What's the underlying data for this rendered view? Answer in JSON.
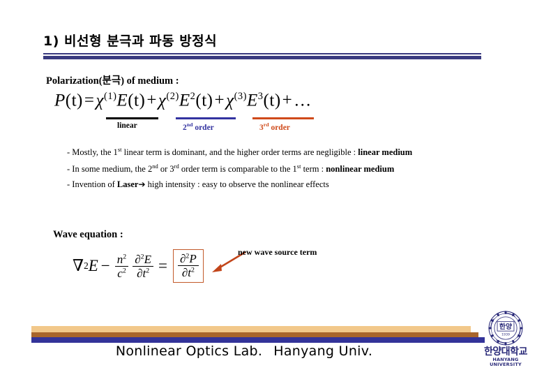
{
  "slide": {
    "title": "1) 비선형 분극과 파동 방정식",
    "rule_color": "#393a7f"
  },
  "polarization": {
    "heading": "Polarization(분극) of medium :",
    "equation_plain": "P(t) = χ(1)E(t) + χ(2)E2(t) + χ(3)E3(t) + ...",
    "lhs": "P",
    "lhs_arg": "(t)",
    "equals": "=",
    "terms": [
      {
        "chi": "χ",
        "chi_sup": "(1)",
        "field": "E",
        "field_sup": "",
        "arg": "(t)"
      },
      {
        "chi": "χ",
        "chi_sup": "(2)",
        "field": "E",
        "field_sup": "2",
        "arg": "(t)"
      },
      {
        "chi": "χ",
        "chi_sup": "(3)",
        "field": "E",
        "field_sup": "3",
        "arg": "(t)"
      }
    ],
    "plus": "+",
    "ellipsis": "…",
    "order_markers": [
      {
        "label_main": "linear",
        "label_sup": "",
        "label_tail": "",
        "color": "#000000"
      },
      {
        "label_main": "2",
        "label_sup": "nd",
        "label_tail": " order",
        "color": "#3333a0"
      },
      {
        "label_main": "3",
        "label_sup": "rd",
        "label_tail": " order",
        "color": "#cf4a1a"
      }
    ]
  },
  "bullets": [
    {
      "dash": "- ",
      "pre": "Mostly, the 1",
      "sup": "st",
      "mid": " linear term is dominant, and the higher order terms are negligible : ",
      "bold": "linear medium",
      "post": ""
    },
    {
      "dash": "- ",
      "pre": "In some medium, the 2",
      "sup": "nd",
      "mid": " or 3",
      "sup2": "rd",
      "mid2": " order term is comparable to the 1",
      "sup3": "st",
      "mid3": " term : ",
      "bold": "nonlinear medium",
      "post": ""
    },
    {
      "dash": "- ",
      "pre": "Invention of ",
      "bold": "Laser",
      "arrow": "➔",
      "post": " high intensity : easy to observe the nonlinear effects"
    }
  ],
  "wave": {
    "heading": "Wave equation :",
    "equation_plain": "∇²E − (n²/c²)(∂²E/∂t²) = ∂²P/∂t²",
    "nabla": "∇",
    "nabla_sup": "2",
    "field": "E",
    "minus": "−",
    "frac1_num": "n",
    "frac1_num_sup": "2",
    "frac1_den": "c",
    "frac1_den_sup": "2",
    "frac2_num_d": "∂",
    "frac2_num_sup": "2",
    "frac2_num_field": "E",
    "frac2_den_d": "∂",
    "frac2_den_var": "t",
    "frac2_den_sup": "2",
    "equals": "=",
    "source_num_d": "∂",
    "source_num_sup": "2",
    "source_num_field": "P",
    "source_den_d": "∂",
    "source_den_var": "t",
    "source_den_sup": "2",
    "box_color": "#c25a2a",
    "annotation": "new wave source term",
    "arrow_color": "#c2451a"
  },
  "footer": {
    "lab": "Nonlinear Optics Lab.",
    "university": "Hanyang Univ.",
    "bar_tan": "#f2c88a",
    "bar_bronze": "#a8652c",
    "bar_navy": "#333399",
    "logo_kr": "한양대학교",
    "logo_en": "HANYANG UNIVERSITY",
    "logo_center": "한양",
    "logo_year": "1939",
    "logo_color": "#2b2b7a"
  }
}
